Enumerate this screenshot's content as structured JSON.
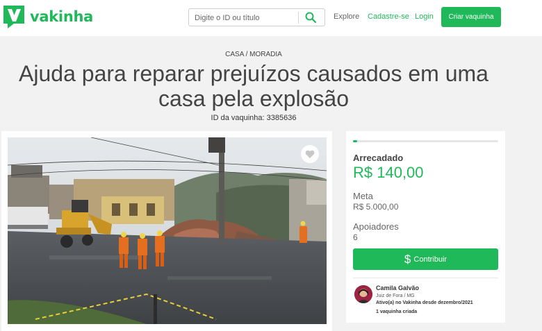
{
  "brand": {
    "name": "vakinha",
    "color": "#1fb959"
  },
  "header": {
    "search_placeholder": "Digite o ID ou título",
    "nav": {
      "explore": "Explore",
      "signup": "Cadastre-se",
      "login": "Login"
    },
    "cta": "Criar vaquinha"
  },
  "campaign": {
    "category": "CASA / MORADIA",
    "title": "Ajuda para reparar prejuízos causados em uma casa pela explosão",
    "id_text": "ID da vaquinha: 3385636"
  },
  "donation": {
    "raised_label": "Arrecadado",
    "raised_value": "R$ 140,00",
    "goal_label": "Meta",
    "goal_value": "R$ 5.000,00",
    "supporters_label": "Apoiadores",
    "supporters_value": "6",
    "progress_fraction": 0.028,
    "contribute_icon": "dollar-icon",
    "contribute_label": "Contribuir"
  },
  "organizer": {
    "name": "Camila Galvão",
    "location": "Juiz de Fora / MG",
    "active_since": "Ativo(a) no Vakinha desde dezembro/2021",
    "campaigns_created": "1 vaquinha criada"
  },
  "icons": {
    "search": "search-icon",
    "favorite": "heart-icon",
    "logo": "vakinha-logo-icon"
  }
}
